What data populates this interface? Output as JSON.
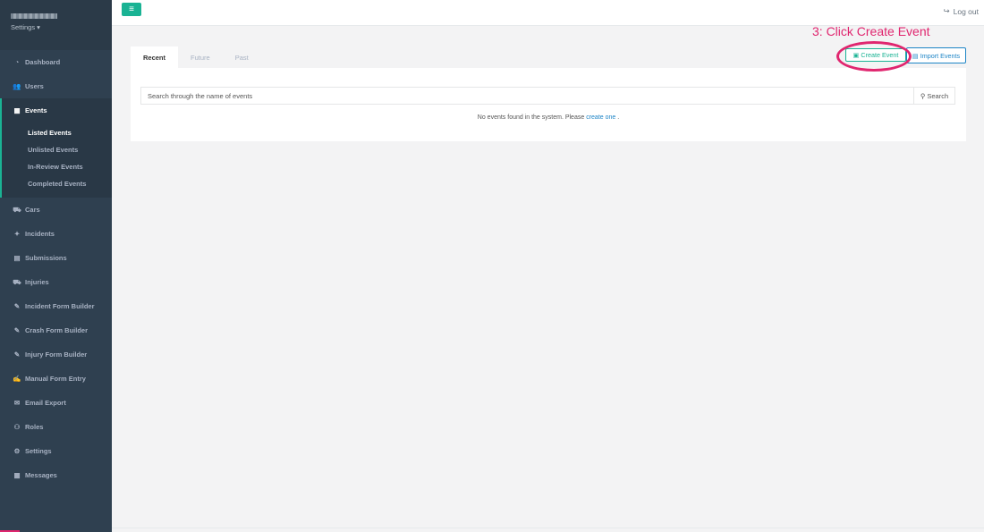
{
  "sidebar": {
    "settings_label": "Settings ▾",
    "items": [
      {
        "label": "Dashboard",
        "icon": "dashboard-icon",
        "glyph": "◔"
      },
      {
        "label": "Users",
        "icon": "users-icon",
        "glyph": "👥"
      },
      {
        "label": "Events",
        "icon": "calendar-icon",
        "glyph": "▦"
      },
      {
        "label": "Cars",
        "icon": "car-icon",
        "glyph": "⛟"
      },
      {
        "label": "Incidents",
        "icon": "crash-icon",
        "glyph": "✦"
      },
      {
        "label": "Submissions",
        "icon": "file-icon",
        "glyph": "▤"
      },
      {
        "label": "Injuries",
        "icon": "ambulance-icon",
        "glyph": "⛟"
      },
      {
        "label": "Incident Form Builder",
        "icon": "wrench-icon",
        "glyph": "✎"
      },
      {
        "label": "Crash Form Builder",
        "icon": "wrench-icon",
        "glyph": "✎"
      },
      {
        "label": "Injury Form Builder",
        "icon": "wrench-icon",
        "glyph": "✎"
      },
      {
        "label": "Manual Form Entry",
        "icon": "edit-icon",
        "glyph": "✍"
      },
      {
        "label": "Email Export",
        "icon": "envelope-icon",
        "glyph": "✉"
      },
      {
        "label": "Roles",
        "icon": "user-cog-icon",
        "glyph": "⚇"
      },
      {
        "label": "Settings",
        "icon": "gear-icon",
        "glyph": "⚙"
      },
      {
        "label": "Messages",
        "icon": "calendar-icon",
        "glyph": "▦"
      }
    ],
    "events_sub": [
      "Listed Events",
      "Unlisted Events",
      "In-Review Events",
      "Completed Events"
    ]
  },
  "topbar": {
    "menu_glyph": "≡",
    "logout_label": "Log out",
    "logout_glyph": "↪"
  },
  "annotation": {
    "text": "3: Click Create Event"
  },
  "main": {
    "tabs": [
      "Recent",
      "Future",
      "Past"
    ],
    "create_button": "Create Event",
    "import_button": "Import Events",
    "search_placeholder": "Search through the name of events",
    "search_button": "Search",
    "empty_text": "No events found in the system. Please",
    "empty_link": "create one",
    "empty_suffix": "."
  },
  "colors": {
    "sidebar": "#2f4050",
    "accent": "#1ab394",
    "link": "#1c84c6",
    "annotation": "#e0266f"
  }
}
